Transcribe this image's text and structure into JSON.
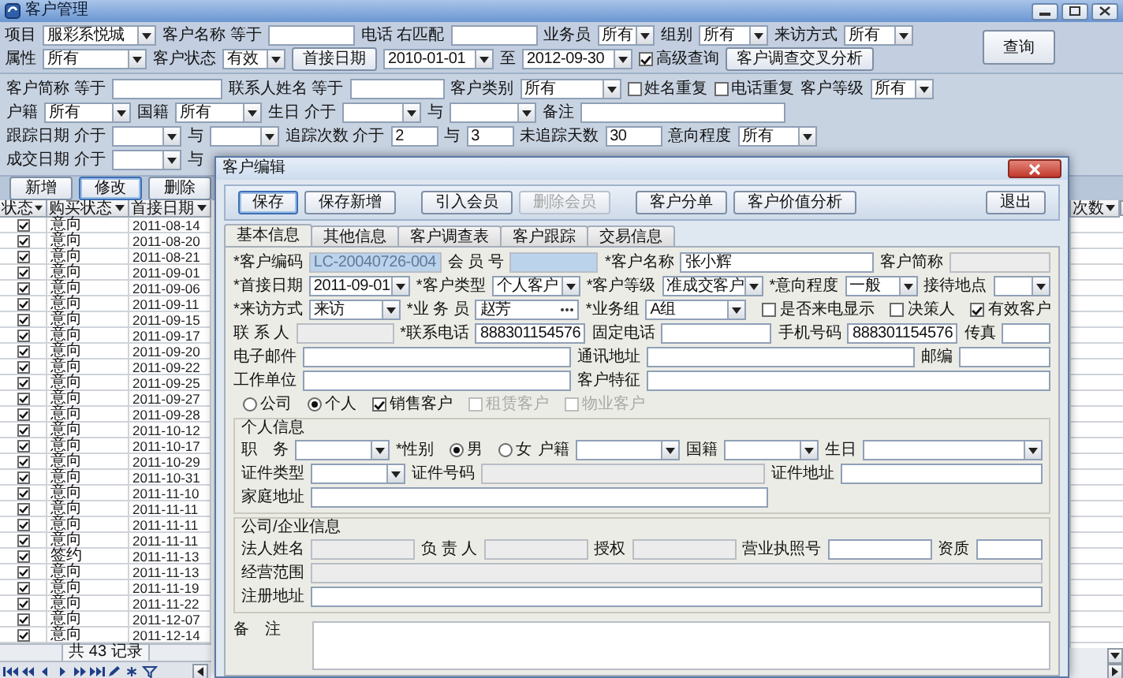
{
  "window": {
    "title": "客户管理"
  },
  "query_panel": {
    "rows": [
      {
        "items": [
          {
            "kind": "label",
            "text": "项目"
          },
          {
            "kind": "combo",
            "value": "服彩系悦城"
          },
          {
            "kind": "label",
            "text": "客户名称 等于"
          },
          {
            "kind": "text",
            "readonly": false,
            "locked": false
          },
          {
            "kind": "label",
            "text": "电话 右匹配"
          },
          {
            "kind": "text",
            "readonly": false,
            "locked": false
          },
          {
            "kind": "label",
            "text": "业务员"
          },
          {
            "kind": "combo",
            "value": "所有"
          },
          {
            "kind": "label",
            "text": "组别"
          },
          {
            "kind": "combo",
            "value": "所有"
          },
          {
            "kind": "label",
            "text": "来访方式"
          },
          {
            "kind": "combo",
            "value": "所有"
          }
        ]
      },
      {
        "items": [
          {
            "kind": "label",
            "text": "属性"
          },
          {
            "kind": "combo",
            "value": "所有"
          },
          {
            "kind": "label",
            "text": "客户状态"
          },
          {
            "kind": "combo",
            "value": "有效"
          },
          {
            "kind": "button",
            "label": "首接日期"
          },
          {
            "kind": "combo",
            "value": "2010-01-01"
          },
          {
            "kind": "label",
            "text": "至"
          },
          {
            "kind": "combo",
            "value": "2012-09-30"
          },
          {
            "kind": "check",
            "label": "高级查询",
            "checked": true,
            "disabled": false
          },
          {
            "kind": "button",
            "label": "客户调查交叉分析"
          }
        ]
      }
    ],
    "query_button": "查询"
  },
  "filter_panel": {
    "rows": [
      {
        "items": [
          {
            "kind": "label",
            "text": "客户简称 等于"
          },
          {
            "kind": "text",
            "readonly": false,
            "locked": false
          },
          {
            "kind": "label",
            "text": "联系人姓名 等于"
          },
          {
            "kind": "text",
            "readonly": false,
            "locked": false
          },
          {
            "kind": "label",
            "text": "客户类别"
          },
          {
            "kind": "combo",
            "value": "所有"
          },
          {
            "kind": "check",
            "label": "姓名重复",
            "checked": false,
            "disabled": false
          },
          {
            "kind": "check",
            "label": "电话重复",
            "checked": false,
            "disabled": false
          },
          {
            "kind": "label",
            "text": "客户等级"
          },
          {
            "kind": "combo",
            "value": "所有"
          }
        ]
      },
      {
        "items": [
          {
            "kind": "label",
            "text": "户籍"
          },
          {
            "kind": "combo",
            "value": "所有"
          },
          {
            "kind": "label",
            "text": "国籍"
          },
          {
            "kind": "combo",
            "value": "所有"
          },
          {
            "kind": "label",
            "text": "生日 介于"
          },
          {
            "kind": "combo"
          },
          {
            "kind": "label",
            "text": "与"
          },
          {
            "kind": "combo"
          },
          {
            "kind": "label",
            "text": "备注"
          },
          {
            "kind": "text",
            "readonly": false,
            "locked": false
          }
        ]
      },
      {
        "items": [
          {
            "kind": "label",
            "text": "跟踪日期 介于"
          },
          {
            "kind": "combo"
          },
          {
            "kind": "label",
            "text": "与"
          },
          {
            "kind": "combo"
          },
          {
            "kind": "label",
            "text": "追踪次数 介于"
          },
          {
            "kind": "text",
            "readonly": false,
            "locked": false,
            "value": "2"
          },
          {
            "kind": "label",
            "text": "与"
          },
          {
            "kind": "text",
            "readonly": false,
            "locked": false,
            "value": "3"
          },
          {
            "kind": "label",
            "text": "未追踪天数"
          },
          {
            "kind": "text",
            "readonly": false,
            "locked": false,
            "value": "30"
          },
          {
            "kind": "label",
            "text": "意向程度"
          },
          {
            "kind": "combo",
            "value": "所有"
          }
        ]
      },
      {
        "items": [
          {
            "kind": "label",
            "text": "成交日期 介于"
          },
          {
            "kind": "combo"
          },
          {
            "kind": "label",
            "text": "与"
          }
        ]
      }
    ]
  },
  "list_buttons": [
    {
      "label": "新增",
      "focused": false
    },
    {
      "label": "修改",
      "focused": true
    },
    {
      "label": "删除",
      "focused": false
    }
  ],
  "grid": {
    "columns": [
      "状态",
      "购买状态",
      "首接日期"
    ],
    "rows": [
      {
        "checked": true,
        "status": "意向",
        "first_date": "2011-08-14"
      },
      {
        "checked": true,
        "status": "意向",
        "first_date": "2011-08-20"
      },
      {
        "checked": true,
        "status": "意向",
        "first_date": "2011-08-21"
      },
      {
        "checked": true,
        "status": "意向",
        "first_date": "2011-09-01"
      },
      {
        "checked": true,
        "status": "意向",
        "first_date": "2011-09-06"
      },
      {
        "checked": true,
        "status": "意向",
        "first_date": "2011-09-11"
      },
      {
        "checked": true,
        "status": "意向",
        "first_date": "2011-09-15"
      },
      {
        "checked": true,
        "status": "意向",
        "first_date": "2011-09-17"
      },
      {
        "checked": true,
        "status": "意向",
        "first_date": "2011-09-20"
      },
      {
        "checked": true,
        "status": "意向",
        "first_date": "2011-09-22"
      },
      {
        "checked": true,
        "status": "意向",
        "first_date": "2011-09-25"
      },
      {
        "checked": true,
        "status": "意向",
        "first_date": "2011-09-27"
      },
      {
        "checked": true,
        "status": "意向",
        "first_date": "2011-09-28"
      },
      {
        "checked": true,
        "status": "意向",
        "first_date": "2011-10-12"
      },
      {
        "checked": true,
        "status": "意向",
        "first_date": "2011-10-17"
      },
      {
        "checked": true,
        "status": "意向",
        "first_date": "2011-10-29"
      },
      {
        "checked": true,
        "status": "意向",
        "first_date": "2011-10-31"
      },
      {
        "checked": true,
        "status": "意向",
        "first_date": "2011-11-10"
      },
      {
        "checked": true,
        "status": "意向",
        "first_date": "2011-11-11"
      },
      {
        "checked": true,
        "status": "意向",
        "first_date": "2011-11-11"
      },
      {
        "checked": true,
        "status": "意向",
        "first_date": "2011-11-11"
      },
      {
        "checked": true,
        "status": "签约",
        "first_date": "2011-11-13"
      },
      {
        "checked": true,
        "status": "意向",
        "first_date": "2011-11-13"
      },
      {
        "checked": true,
        "status": "意向",
        "first_date": "2011-11-19"
      },
      {
        "checked": true,
        "status": "意向",
        "first_date": "2011-11-22"
      },
      {
        "checked": true,
        "status": "意向",
        "first_date": "2011-12-07"
      },
      {
        "checked": true,
        "status": "意向",
        "first_date": "2011-12-14"
      }
    ],
    "record_count": "共 43 记录",
    "right_column": "次数"
  },
  "dialog": {
    "title": "客户编辑",
    "toolbar": [
      {
        "label": "保存",
        "focused": true,
        "disabled": false
      },
      {
        "label": "保存新增",
        "focused": false,
        "disabled": false
      },
      {
        "label": "引入会员",
        "focused": false,
        "disabled": false
      },
      {
        "label": "删除会员",
        "focused": false,
        "disabled": true
      },
      {
        "label": "客户分单",
        "focused": false,
        "disabled": false
      },
      {
        "label": "客户价值分析",
        "focused": false,
        "disabled": false
      },
      {
        "label": "退出",
        "focused": false,
        "disabled": false
      }
    ],
    "tabs": [
      {
        "label": "基本信息",
        "selected": true
      },
      {
        "label": "其他信息",
        "selected": false
      },
      {
        "label": "客户调查表",
        "selected": false
      },
      {
        "label": "客户跟踪",
        "selected": false
      },
      {
        "label": "交易信息",
        "selected": false
      }
    ],
    "form": {
      "rows": [
        {
          "items": [
            {
              "kind": "label",
              "text": "*客户编码"
            },
            {
              "kind": "text",
              "readonly": true,
              "locked": true,
              "value": "LC-20040726-004"
            },
            {
              "kind": "label",
              "text": "会 员 号"
            },
            {
              "kind": "text",
              "readonly": true,
              "locked": true
            },
            {
              "kind": "label",
              "text": "*客户名称"
            },
            {
              "kind": "text",
              "readonly": false,
              "locked": false,
              "value": "张小辉"
            },
            {
              "kind": "label",
              "text": "客户简称"
            },
            {
              "kind": "text",
              "readonly": true,
              "locked": false
            }
          ]
        },
        {
          "items": [
            {
              "kind": "label",
              "text": "*首接日期"
            },
            {
              "kind": "combo",
              "value": "2011-09-01"
            },
            {
              "kind": "label",
              "text": "*客户类型"
            },
            {
              "kind": "combo",
              "value": "个人客户"
            },
            {
              "kind": "label",
              "text": "*客户等级"
            },
            {
              "kind": "combo",
              "value": "准成交客户"
            },
            {
              "kind": "label",
              "text": "*意向程度"
            },
            {
              "kind": "combo",
              "value": "一般"
            },
            {
              "kind": "label",
              "text": "接待地点"
            },
            {
              "kind": "combo"
            }
          ]
        },
        {
          "items": [
            {
              "kind": "label",
              "text": "*来访方式"
            },
            {
              "kind": "combo",
              "value": "来访"
            },
            {
              "kind": "label",
              "text": "*业 务 员"
            },
            {
              "kind": "lookup",
              "value": "赵芳"
            },
            {
              "kind": "label",
              "text": "*业务组"
            },
            {
              "kind": "combo",
              "value": "A组"
            },
            {
              "kind": "check",
              "label": "是否来电显示",
              "checked": false,
              "disabled": false
            },
            {
              "kind": "check",
              "label": "决策人",
              "checked": false,
              "disabled": false
            },
            {
              "kind": "check",
              "label": "有效客户",
              "checked": true,
              "disabled": false
            }
          ]
        },
        {
          "items": [
            {
              "kind": "label",
              "text": "联 系 人"
            },
            {
              "kind": "text",
              "readonly": true,
              "locked": false
            },
            {
              "kind": "label",
              "text": "*联系电话"
            },
            {
              "kind": "text",
              "readonly": false,
              "locked": false,
              "value": "888301154576"
            },
            {
              "kind": "label",
              "text": "固定电话"
            },
            {
              "kind": "text",
              "readonly": false,
              "locked": false
            },
            {
              "kind": "label",
              "text": "手机号码"
            },
            {
              "kind": "text",
              "readonly": false,
              "locked": false,
              "value": "888301154576"
            },
            {
              "kind": "label",
              "text": "传真"
            },
            {
              "kind": "text",
              "readonly": false,
              "locked": false
            }
          ]
        },
        {
          "items": [
            {
              "kind": "label",
              "text": "电子邮件"
            },
            {
              "kind": "text",
              "readonly": false,
              "locked": false
            },
            {
              "kind": "label",
              "text": "通讯地址"
            },
            {
              "kind": "text",
              "readonly": false,
              "locked": false
            },
            {
              "kind": "label",
              "text": "邮编"
            },
            {
              "kind": "text",
              "readonly": false,
              "locked": false
            }
          ]
        },
        {
          "items": [
            {
              "kind": "label",
              "text": "工作单位"
            },
            {
              "kind": "text",
              "readonly": false,
              "locked": false
            },
            {
              "kind": "label",
              "text": "客户特征"
            },
            {
              "kind": "text",
              "readonly": false,
              "locked": false
            }
          ]
        },
        {
          "items": [
            {
              "kind": "radio",
              "label": "公司",
              "selected": false
            },
            {
              "kind": "radio",
              "label": "个人",
              "selected": true
            },
            {
              "kind": "check",
              "label": "销售客户",
              "checked": true,
              "disabled": false
            },
            {
              "kind": "check",
              "label": "租赁客户",
              "checked": false,
              "disabled": true
            },
            {
              "kind": "check",
              "label": "物业客户",
              "checked": false,
              "disabled": true
            }
          ]
        }
      ]
    },
    "personal": {
      "title": "个人信息",
      "rows": [
        {
          "items": [
            {
              "kind": "label",
              "text": "职　务"
            },
            {
              "kind": "combo"
            },
            {
              "kind": "label",
              "text": "*性别"
            },
            {
              "kind": "radio",
              "label": "男",
              "selected": true
            },
            {
              "kind": "radio",
              "label": "女",
              "selected": false
            },
            {
              "kind": "label",
              "text": "户籍"
            },
            {
              "kind": "combo"
            },
            {
              "kind": "label",
              "text": "国籍"
            },
            {
              "kind": "combo"
            },
            {
              "kind": "label",
              "text": "生日"
            },
            {
              "kind": "combo"
            }
          ]
        },
        {
          "items": [
            {
              "kind": "label",
              "text": "证件类型"
            },
            {
              "kind": "combo"
            },
            {
              "kind": "label",
              "text": "证件号码"
            },
            {
              "kind": "text",
              "readonly": true,
              "locked": false
            },
            {
              "kind": "label",
              "text": "证件地址"
            },
            {
              "kind": "text",
              "readonly": false,
              "locked": false
            }
          ]
        },
        {
          "items": [
            {
              "kind": "label",
              "text": "家庭地址"
            },
            {
              "kind": "text",
              "readonly": false,
              "locked": false
            }
          ]
        }
      ]
    },
    "company": {
      "title": "公司/企业信息",
      "rows": [
        {
          "items": [
            {
              "kind": "label",
              "text": "法人姓名"
            },
            {
              "kind": "text",
              "readonly": true,
              "locked": false
            },
            {
              "kind": "label",
              "text": "负 责 人"
            },
            {
              "kind": "text",
              "readonly": true,
              "locked": false
            },
            {
              "kind": "label",
              "text": "授权"
            },
            {
              "kind": "text",
              "readonly": true,
              "locked": false
            },
            {
              "kind": "label",
              "text": "营业执照号"
            },
            {
              "kind": "text",
              "readonly": false,
              "locked": false
            },
            {
              "kind": "label",
              "text": "资质"
            },
            {
              "kind": "text",
              "readonly": false,
              "locked": false
            }
          ]
        },
        {
          "items": [
            {
              "kind": "label",
              "text": "经营范围"
            },
            {
              "kind": "text",
              "readonly": true,
              "locked": false
            }
          ]
        },
        {
          "items": [
            {
              "kind": "label",
              "text": "注册地址"
            },
            {
              "kind": "text",
              "readonly": false,
              "locked": false
            }
          ]
        }
      ]
    },
    "remarks": {
      "label": "备　注"
    }
  }
}
